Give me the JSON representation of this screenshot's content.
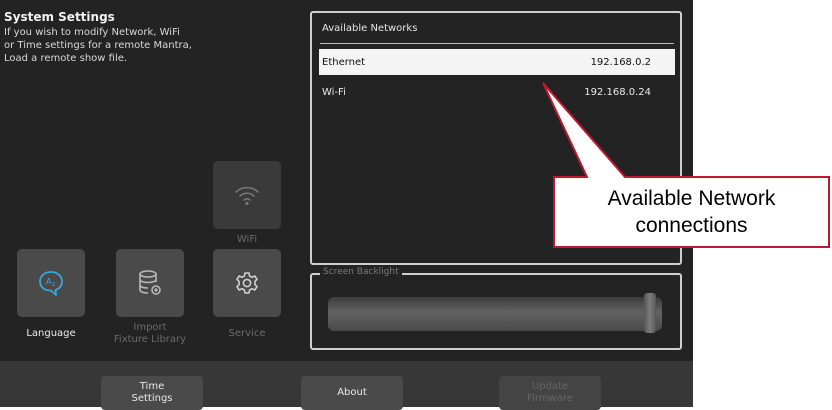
{
  "header": {
    "title": "System Settings",
    "description": "If you wish to modify Network, WiFi\nor Time settings for a remote Mantra,\nLoad a remote show file."
  },
  "tiles": [
    {
      "key": "wifi",
      "label": "WiFi",
      "icon": "wifi-icon",
      "enabled": false
    },
    {
      "key": "language",
      "label": "Language",
      "icon": "language-icon",
      "enabled": true
    },
    {
      "key": "import",
      "label": "Import\nFixture Library",
      "icon": "database-icon",
      "enabled": false
    },
    {
      "key": "service",
      "label": "Service",
      "icon": "gear-icon",
      "enabled": false
    }
  ],
  "networks": {
    "heading": "Available Networks",
    "items": [
      {
        "name": "Ethernet",
        "ip": "192.168.0.2",
        "selected": true
      },
      {
        "name": "Wi-Fi",
        "ip": "192.168.0.24",
        "selected": false
      }
    ]
  },
  "backlight": {
    "label": "Screen Backlight",
    "level_fraction": 0.98
  },
  "footer": {
    "time_settings": "Time\nSettings",
    "about": "About",
    "update_firmware": "Update\nFirmware"
  },
  "callout": {
    "text": "Available Network\nconnections"
  },
  "colors": {
    "panel": "#232323",
    "callout_border": "#c0182e",
    "language_icon": "#3aa6e0"
  }
}
